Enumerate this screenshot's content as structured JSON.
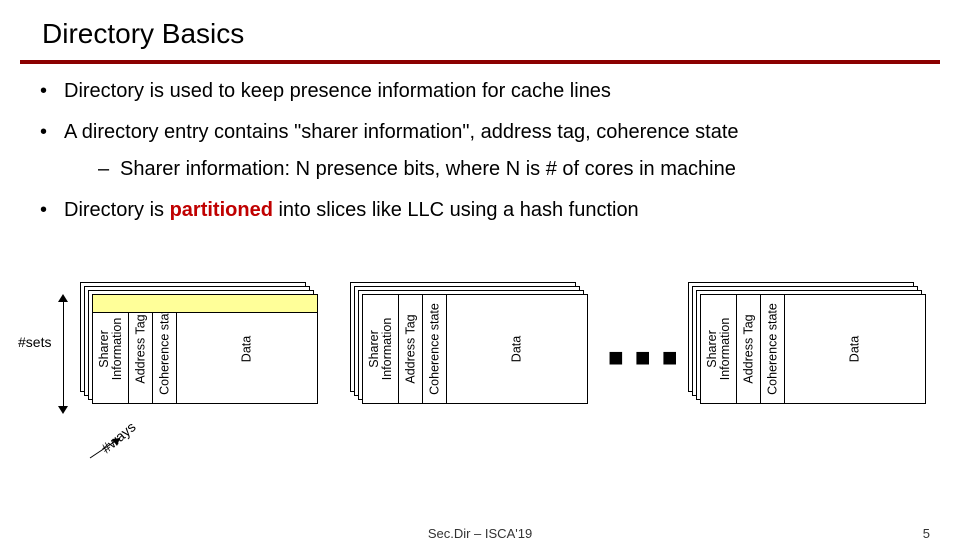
{
  "title": "Directory Basics",
  "bullets": {
    "b1": "Directory is used to keep presence information for cache lines",
    "b2": "A directory entry contains \"sharer information\", address tag, coherence state",
    "b2_sub": "Sharer information: N presence bits, where N is # of cores in machine",
    "b3_pre": "Directory is ",
    "b3_em": "partitioned",
    "b3_post": " into slices like LLC using a hash function"
  },
  "labels": {
    "sets": "#sets",
    "ways": "#ways",
    "sharer_l1": "Sharer",
    "sharer_l2": "Information",
    "tag": "Address Tag",
    "coh": "Coherence state",
    "data": "Data",
    "dots": "■ ■ ■ ■ ■"
  },
  "footer": {
    "center": "Sec.Dir – ISCA'19",
    "right": "5"
  }
}
